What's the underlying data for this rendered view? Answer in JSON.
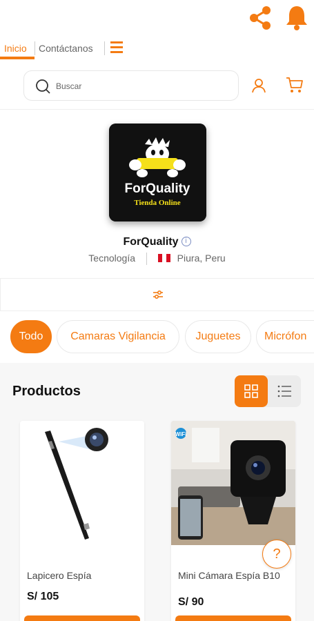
{
  "nav": {
    "home": "Inicio",
    "contact": "Contáctanos"
  },
  "search": {
    "placeholder": "Buscar"
  },
  "store": {
    "name": "ForQuality",
    "logo_text": "ForQuality",
    "logo_subtext": "Tienda Online",
    "category": "Tecnología",
    "location": "Piura, Peru"
  },
  "categories": [
    "Todo",
    "Camaras Vigilancia",
    "Juguetes",
    "Micrófon"
  ],
  "products": {
    "title": "Productos",
    "items": [
      {
        "name": "Lapicero Espía",
        "price": "S/ 105"
      },
      {
        "name": "Mini Cámara Espía B10",
        "price": "S/ 90"
      }
    ]
  },
  "help": {
    "label": "?"
  },
  "colors": {
    "accent": "#f47b12",
    "logo_bg": "#111111",
    "logo_yellow": "#f5e01a"
  },
  "icons": [
    "share-icon",
    "bell-icon",
    "menu-icon",
    "search-icon",
    "user-icon",
    "cart-icon",
    "info-icon",
    "peru-flag-icon",
    "filter-icon",
    "grid-view-icon",
    "list-view-icon",
    "help-icon"
  ]
}
